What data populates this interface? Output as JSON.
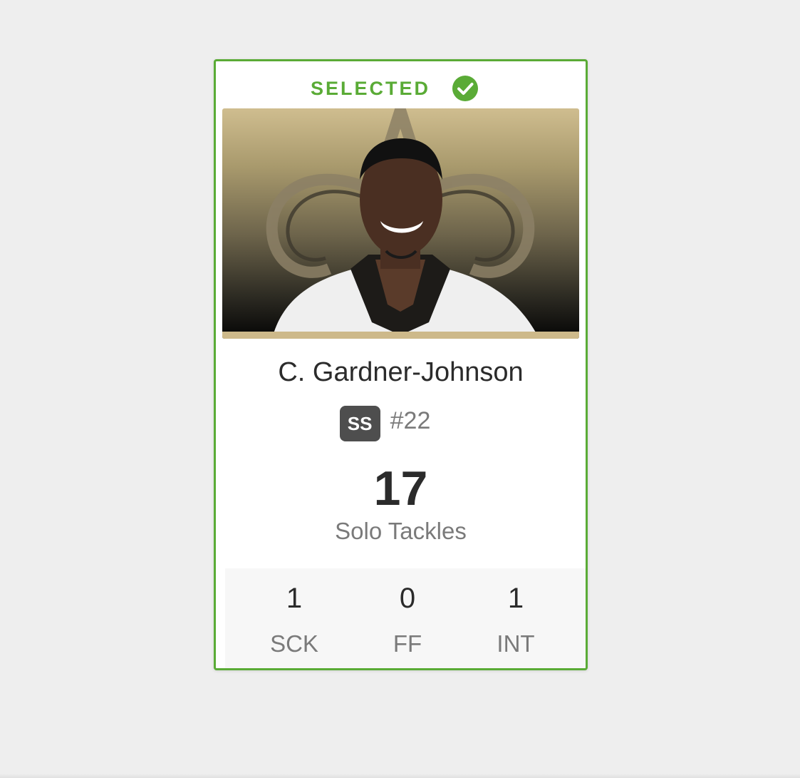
{
  "card": {
    "selected_label": "SELECTED",
    "player_name": "C. Gardner-Johnson",
    "position": "SS",
    "jersey_number": "#22",
    "headline_stat": {
      "value": "17",
      "label": "Solo Tackles"
    },
    "stats": [
      {
        "value": "1",
        "label": "SCK"
      },
      {
        "value": "0",
        "label": "FF"
      },
      {
        "value": "1",
        "label": "INT"
      }
    ]
  },
  "icons": {
    "selected": "check-circle-icon",
    "team_logo": "fleur-de-lis-icon"
  },
  "colors": {
    "selected_green": "#5aab36",
    "team_gold": "#cdb98a",
    "badge_gray": "#4e4e4e",
    "background": "#eeeeee"
  }
}
